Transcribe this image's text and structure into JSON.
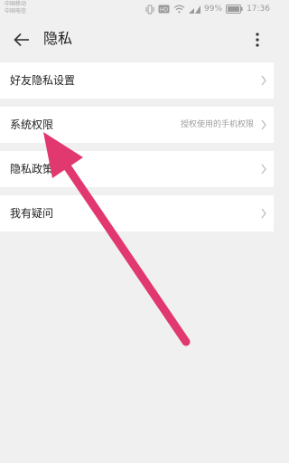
{
  "status_bar": {
    "carrier_1": "中国移动",
    "carrier_2": "中国电信",
    "battery": "99%",
    "time": "17:36",
    "icons": [
      "vibrate-icon",
      "hd-icon",
      "wifi-icon",
      "signal-icon",
      "battery-icon"
    ]
  },
  "app_bar": {
    "title": "隐私",
    "back_icon": "arrow-left-icon",
    "more_icon": "more-vert-icon"
  },
  "settings": {
    "items": [
      {
        "label": "好友隐私设置",
        "hint": ""
      },
      {
        "label": "系统权限",
        "hint": "授权使用的手机权限"
      },
      {
        "label": "隐私政策",
        "hint": ""
      },
      {
        "label": "我有疑问",
        "hint": ""
      }
    ]
  },
  "annotation": {
    "arrow_color": "#e0386f",
    "arrow_points_to": "系统权限"
  },
  "colors": {
    "background": "#f0f0f0",
    "row_background": "#ffffff",
    "text_primary": "#222222",
    "text_secondary": "#9e9e9e"
  }
}
